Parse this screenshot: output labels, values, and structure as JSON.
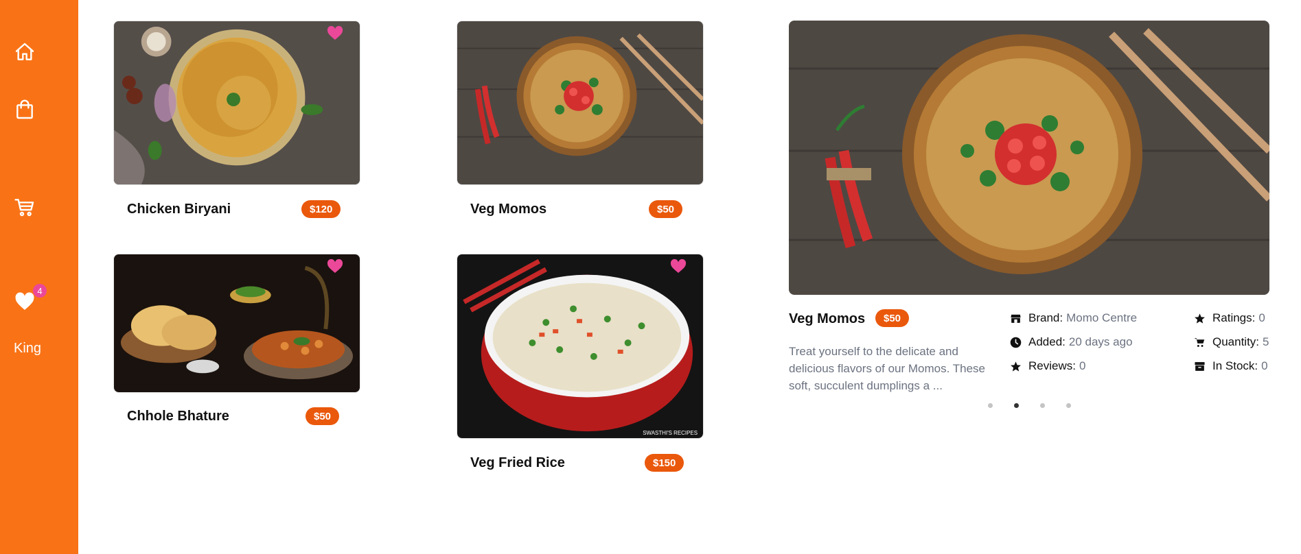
{
  "sidebar": {
    "items": [
      {
        "icon": "home-icon"
      },
      {
        "icon": "shopping-bag-icon"
      },
      {
        "icon": "cart-icon"
      },
      {
        "icon": "heart-icon",
        "badge": "4"
      }
    ],
    "user": "King",
    "color": "#f97316"
  },
  "cards": [
    {
      "title": "Chicken Biryani",
      "price": "$120",
      "favorited": true
    },
    {
      "title": "Veg Momos",
      "price": "$50",
      "favorited": false
    },
    {
      "title": "Chhole Bhature",
      "price": "$50",
      "favorited": true
    },
    {
      "title": "Veg Fried Rice",
      "price": "$150",
      "favorited": true,
      "watermark": "SWASTHI'S RECIPES"
    }
  ],
  "detail": {
    "title": "Veg Momos",
    "price": "$50",
    "description": "Treat yourself to the delicate and delicious flavors of our Momos. These soft, succulent dumplings a ...",
    "brand_label": "Brand:",
    "brand": "Momo Centre",
    "added_label": "Added:",
    "added": "20 days ago",
    "reviews_label": "Reviews:",
    "reviews": "0",
    "ratings_label": "Ratings:",
    "ratings": "0",
    "quantity_label": "Quantity:",
    "quantity": "5",
    "stock_label": "In Stock:",
    "stock": "0",
    "carousel": {
      "count": 4,
      "active_index": 1
    }
  },
  "colors": {
    "accent": "#f97316",
    "price": "#ea580c",
    "heart": "#ec4899"
  }
}
